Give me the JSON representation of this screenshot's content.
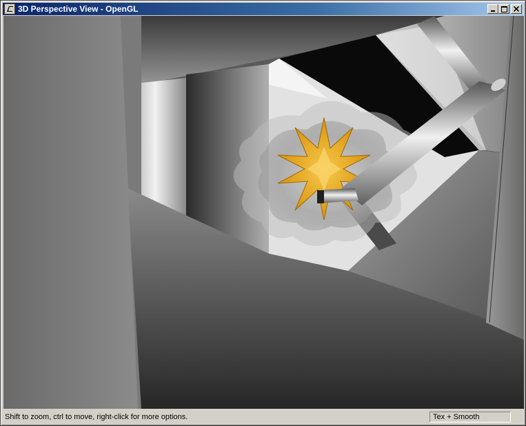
{
  "window": {
    "title": "3D Perspective View - OpenGL",
    "icon": "opengl-app-icon",
    "buttons": {
      "minimize": "minimize-icon",
      "maximize": "maximize-icon",
      "close": "close-icon"
    }
  },
  "viewport": {
    "scene": "3d-perspective-render",
    "accent_color": "#e8a818"
  },
  "statusbar": {
    "hint": "Shift to zoom, ctrl to move, right-click for more options.",
    "render_mode": "Tex + Smooth"
  },
  "colors": {
    "titlebar_start": "#0a246a",
    "titlebar_end": "#a6caf0",
    "chrome": "#d4d0c8"
  }
}
